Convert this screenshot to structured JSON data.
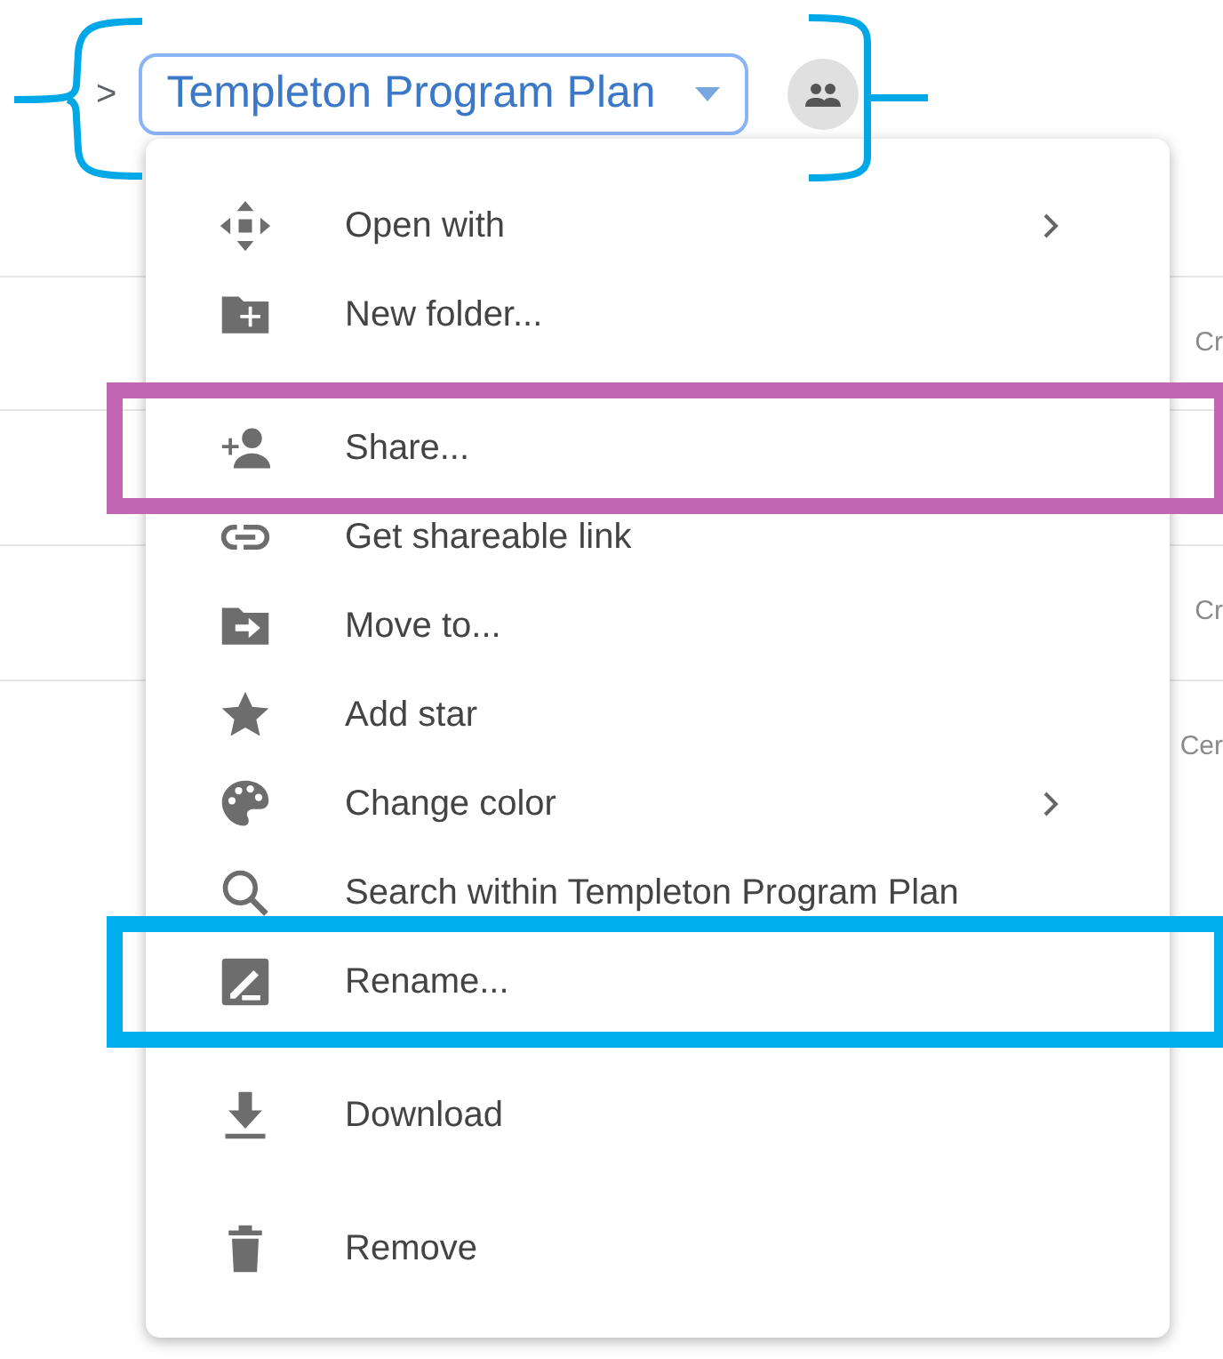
{
  "breadcrumb": {
    "chevron": ">",
    "folder": {
      "label": "Templeton Program Plan",
      "selected": true
    }
  },
  "background_rows": [
    {
      "text": "Cr"
    },
    {
      "text": "Cr"
    },
    {
      "text": "Cer"
    }
  ],
  "menu": [
    {
      "kind": "item",
      "label": "Open with",
      "submenu": true
    },
    {
      "kind": "item",
      "label": "New folder..."
    },
    {
      "kind": "separator"
    },
    {
      "kind": "item",
      "label": "Share...",
      "highlight": {
        "color": "#c066b3"
      }
    },
    {
      "kind": "item",
      "label": "Get shareable link"
    },
    {
      "kind": "item",
      "label": "Move to..."
    },
    {
      "kind": "item",
      "label": "Add star"
    },
    {
      "kind": "item",
      "label": "Change color",
      "submenu": true
    },
    {
      "kind": "item",
      "label": "Search within Templeton Program Plan"
    },
    {
      "kind": "item",
      "label": "Rename...",
      "highlight": {
        "color": "#00aeef"
      }
    },
    {
      "kind": "separator"
    },
    {
      "kind": "item",
      "label": "Download"
    },
    {
      "kind": "separator"
    },
    {
      "kind": "item",
      "label": "Remove"
    }
  ],
  "annotations": {
    "brace": {
      "color": "#00a8e8"
    },
    "bracket": {
      "color": "#00a8e8"
    }
  }
}
